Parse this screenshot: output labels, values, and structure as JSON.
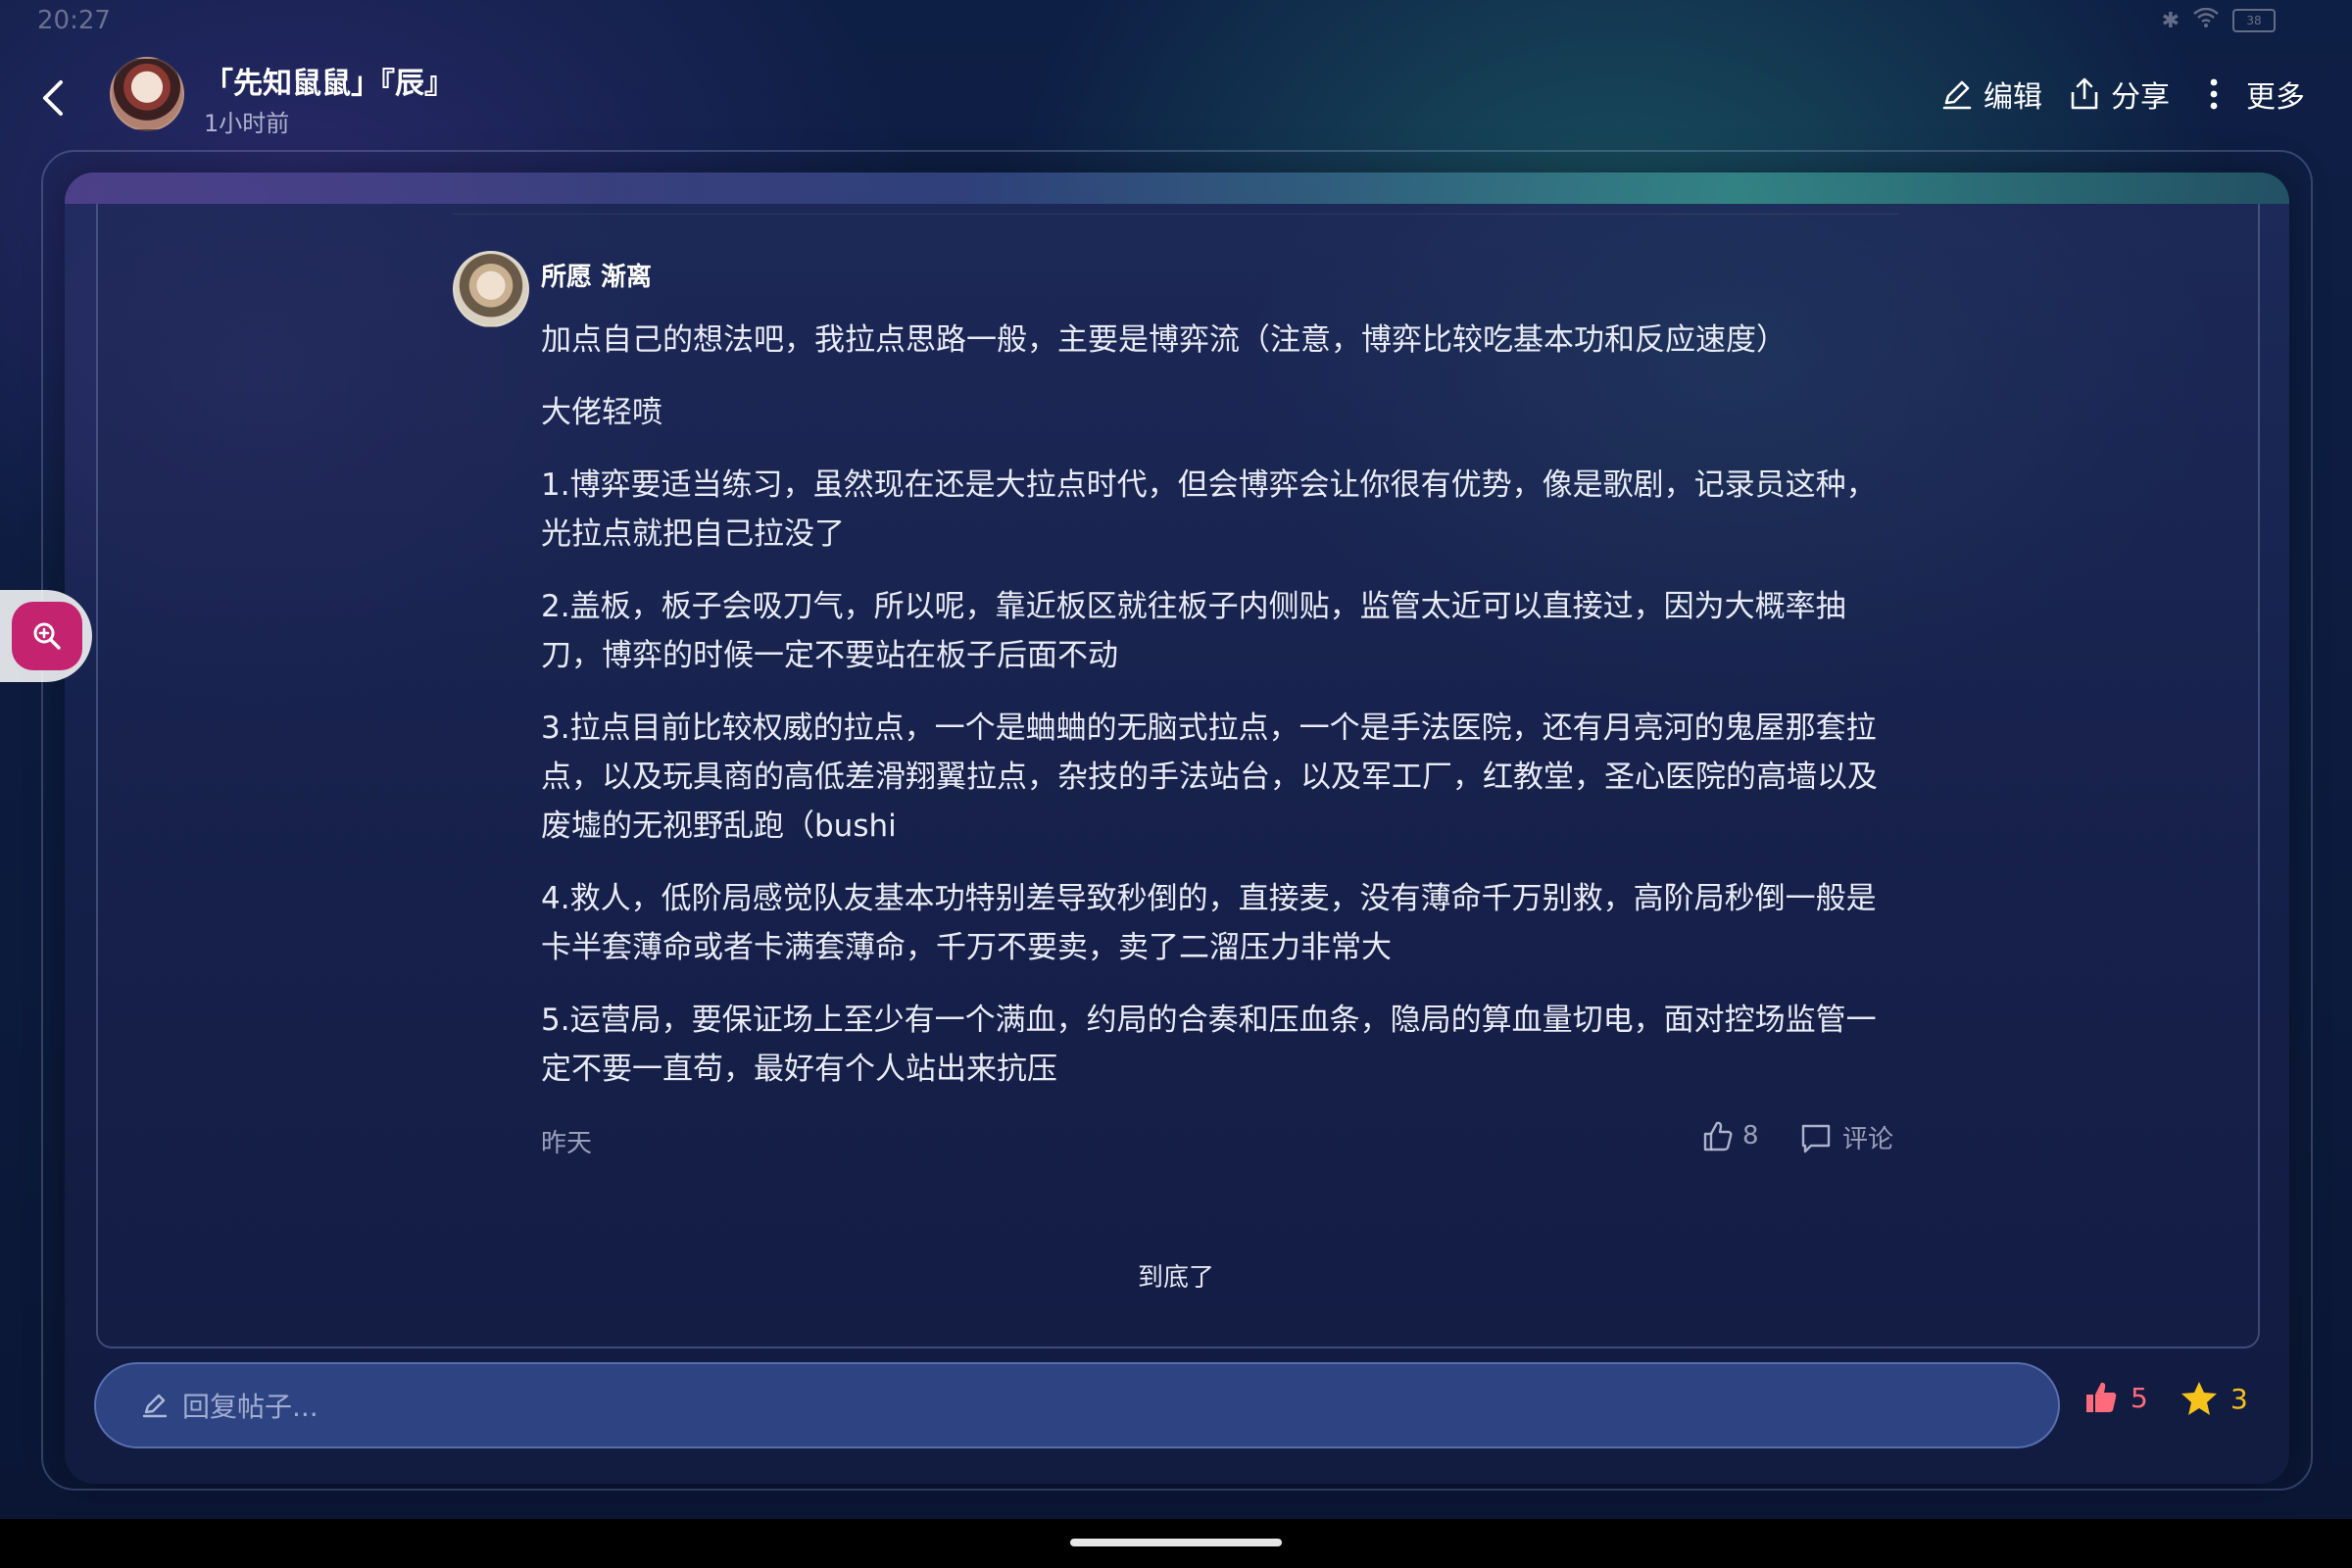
{
  "status_bar": {
    "time": "20:27",
    "battery": "38"
  },
  "header": {
    "title": "「先知鼠鼠」『辰』",
    "time": "1小时前",
    "actions": {
      "edit": "编辑",
      "share": "分享",
      "more": "更多"
    }
  },
  "comment": {
    "author": "所愿  渐离",
    "paragraphs": [
      "加点自己的想法吧，我拉点思路一般，主要是博弈流（注意，博弈比较吃基本功和反应速度）",
      "大佬轻喷",
      "1.博弈要适当练习，虽然现在还是大拉点时代，但会博弈会让你很有优势，像是歌剧，记录员这种，光拉点就把自己拉没了",
      "2.盖板，板子会吸刀气，所以呢，靠近板区就往板子内侧贴，监管太近可以直接过，因为大概率抽刀，博弈的时候一定不要站在板子后面不动",
      "3.拉点目前比较权威的拉点，一个是蛐蛐的无脑式拉点，一个是手法医院，还有月亮河的鬼屋那套拉点，以及玩具商的高低差滑翔翼拉点，杂技的手法站台，以及军工厂，红教堂，圣心医院的高墙以及废墟的无视野乱跑（bushi",
      "4.救人，低阶局感觉队友基本功特别差导致秒倒的，直接麦，没有薄命千万别救，高阶局秒倒一般是卡半套薄命或者卡满套薄命，千万不要卖，卖了二溜压力非常大",
      "5.运营局，要保证场上至少有一个满血，约局的合奏和压血条，隐局的算血量切电，面对控场监管一定不要一直苟，最好有个人站出来抗压"
    ],
    "date": "昨天",
    "like_count": "8",
    "reply_label": "评论"
  },
  "end_text": "到底了",
  "reply_bar": {
    "placeholder": "回复帖子...",
    "like_count": "5",
    "star_count": "3"
  },
  "colors": {
    "like": "#ff6b7a",
    "star": "#f7c21a",
    "zoom_button": "#c4246f",
    "input_bg": "#2e4382"
  }
}
